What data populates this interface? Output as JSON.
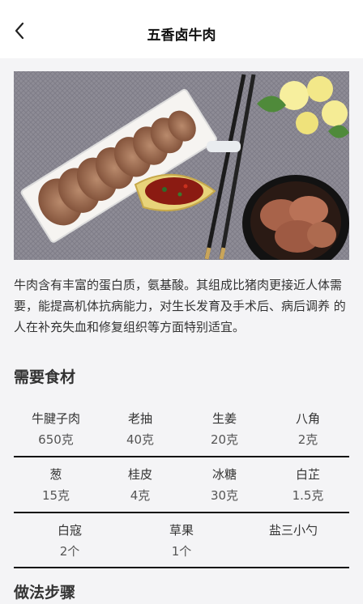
{
  "nav": {
    "title": "五香卤牛肉",
    "back_icon": "chevron-left-icon"
  },
  "photo": {
    "alt": "五香卤牛肉"
  },
  "description": "牛肉含有丰富的蛋白质，氨基酸。其组成比猪肉更接近人体需要，能提高机体抗病能力，对生长发育及手术后、病后调养 的人在补充失血和修复组织等方面特别适宜。",
  "ingredients_title": "需要食材",
  "ingredients": [
    [
      {
        "name": "牛腱子肉",
        "amount": "650克"
      },
      {
        "name": "老抽",
        "amount": "40克"
      },
      {
        "name": "生姜",
        "amount": "20克"
      },
      {
        "name": "八角",
        "amount": "2克"
      }
    ],
    [
      {
        "name": "葱",
        "amount": "15克"
      },
      {
        "name": "桂皮",
        "amount": "4克"
      },
      {
        "name": "冰糖",
        "amount": "30克"
      },
      {
        "name": "白芷",
        "amount": "1.5克"
      }
    ],
    [
      {
        "name": "白寇",
        "amount": "2个"
      },
      {
        "name": "草果",
        "amount": "1个"
      },
      {
        "name": "盐三小勺",
        "amount": ""
      }
    ]
  ],
  "steps_title": "做法步骤",
  "colors": {
    "background": "#f4f4f6",
    "nav_bg": "#ffffff",
    "divider": "#111111",
    "text": "#333333"
  }
}
